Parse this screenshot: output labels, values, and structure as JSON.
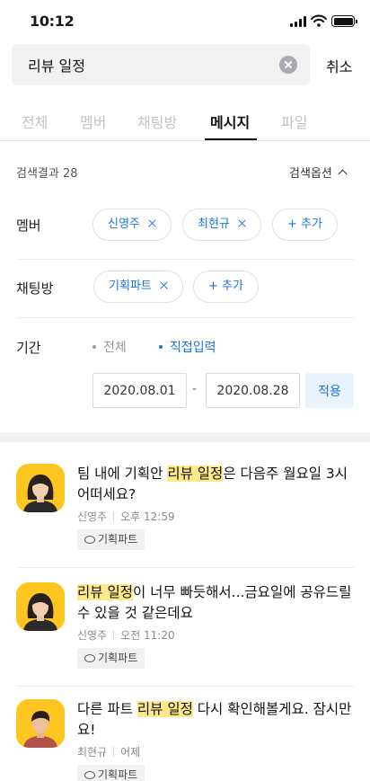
{
  "status_bar": {
    "time": "10:12"
  },
  "search": {
    "query": "리뷰 일정",
    "cancel_label": "취소"
  },
  "tabs": [
    {
      "label": "전체",
      "active": false
    },
    {
      "label": "멤버",
      "active": false
    },
    {
      "label": "채팅방",
      "active": false
    },
    {
      "label": "메시지",
      "active": true
    },
    {
      "label": "파일",
      "active": false
    }
  ],
  "filter": {
    "result_count": "검색결과 28",
    "options_label": "검색옵션",
    "member": {
      "label": "멤버",
      "chips": [
        "신영주",
        "최현규"
      ],
      "add_label": "+ 추가"
    },
    "room": {
      "label": "채팅방",
      "chips": [
        "기획파트"
      ],
      "add_label": "+ 추가"
    },
    "period": {
      "label": "기간",
      "options": [
        "전체",
        "직접입력"
      ],
      "selected": "직접입력",
      "start": "2020.08.01",
      "separator": "-",
      "end": "2020.08.28",
      "apply_label": "적용"
    }
  },
  "messages": [
    {
      "before": "팀 내에 기획안 ",
      "highlight": "리뷰 일정",
      "after": "은 다음주 월요일 3시 어떠세요?",
      "sender": "신영주",
      "time": "오후 12:59",
      "room": "기획파트"
    },
    {
      "before": "",
      "highlight": "리뷰 일정",
      "after": "이 너무 빠듯해서...금요일에 공유드릴 수 있을 것 같은데요",
      "sender": "신영주",
      "time": "오전 11:20",
      "room": "기획파트"
    },
    {
      "before": "다른 파트 ",
      "highlight": "리뷰 일정",
      "after": " 다시 확인해볼게요. 잠시만요!",
      "sender": "최현규",
      "time": "어제",
      "room": "기획파트"
    }
  ],
  "colors": {
    "accent": "#1a73d9",
    "highlight": "#fde88a",
    "avatar_bg": "#ffc621"
  }
}
